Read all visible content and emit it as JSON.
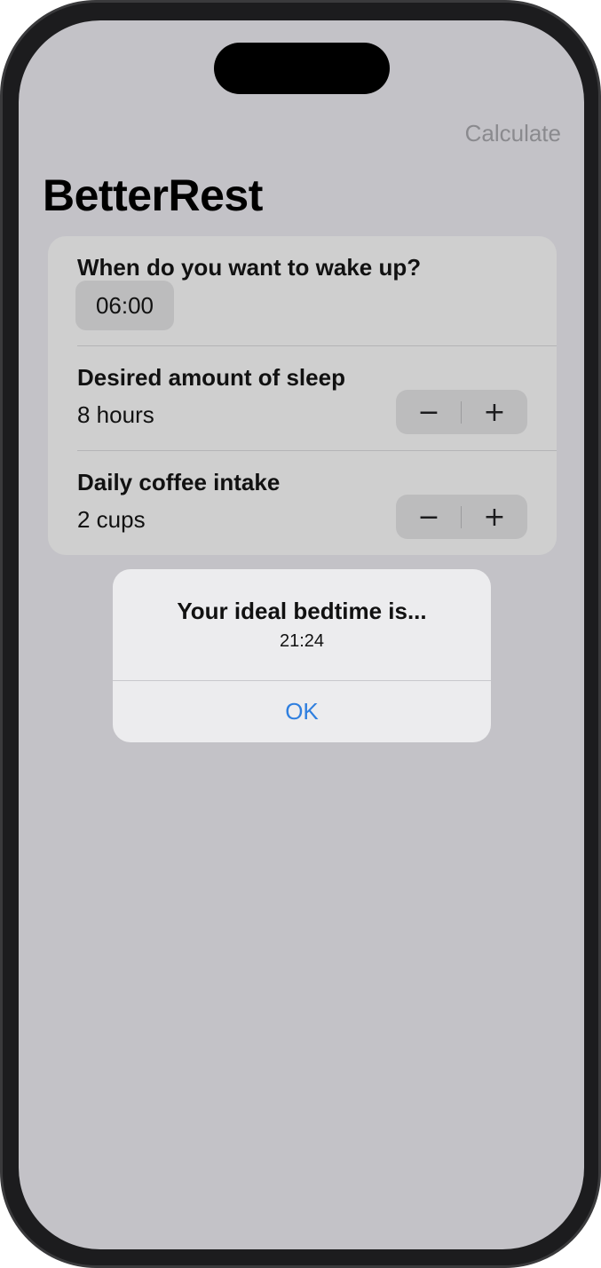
{
  "nav": {
    "action_label": "Calculate"
  },
  "title": "BetterRest",
  "form": {
    "wake_up": {
      "label": "When do you want to wake up?",
      "time": "06:00"
    },
    "sleep": {
      "label": "Desired amount of sleep",
      "value": "8 hours",
      "decrement_symbol": "−",
      "increment_symbol": "+"
    },
    "coffee": {
      "label": "Daily coffee intake",
      "value": "2 cups",
      "decrement_symbol": "−",
      "increment_symbol": "+"
    }
  },
  "alert": {
    "title": "Your ideal bedtime is...",
    "message": "21:24",
    "button_label": "OK"
  },
  "colors": {
    "accent": "#2f7fdf",
    "dimmed_background": "#c3c2c7",
    "alert_background": "#ececee"
  }
}
